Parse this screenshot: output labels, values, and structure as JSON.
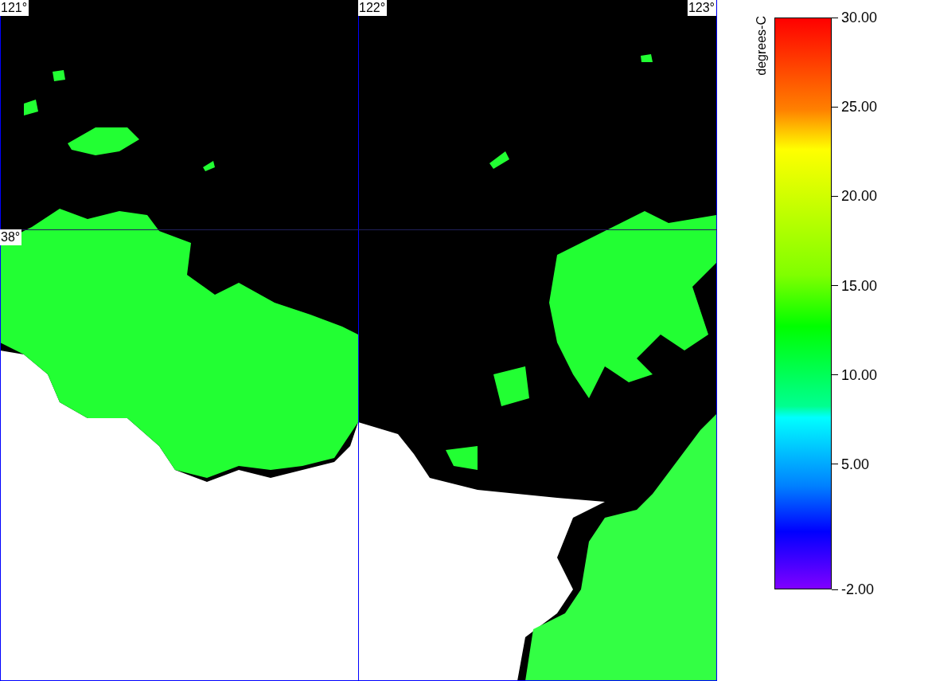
{
  "map": {
    "lon_labels": [
      "121°",
      "122°",
      "123°"
    ],
    "lat_labels": [
      "38°"
    ]
  },
  "colorbar": {
    "title": "degrees-C",
    "ticks": [
      {
        "label": "30.00",
        "level": 1
      },
      {
        "label": "25.00",
        "level": 0.84375
      },
      {
        "label": "20.00",
        "level": 0.6875
      },
      {
        "label": "15.00",
        "level": 0.53125
      },
      {
        "label": "10.00",
        "level": 0.375
      },
      {
        "label": "5.00",
        "level": 0.21875
      },
      {
        "label": "-2.00",
        "level": 0
      }
    ]
  }
}
